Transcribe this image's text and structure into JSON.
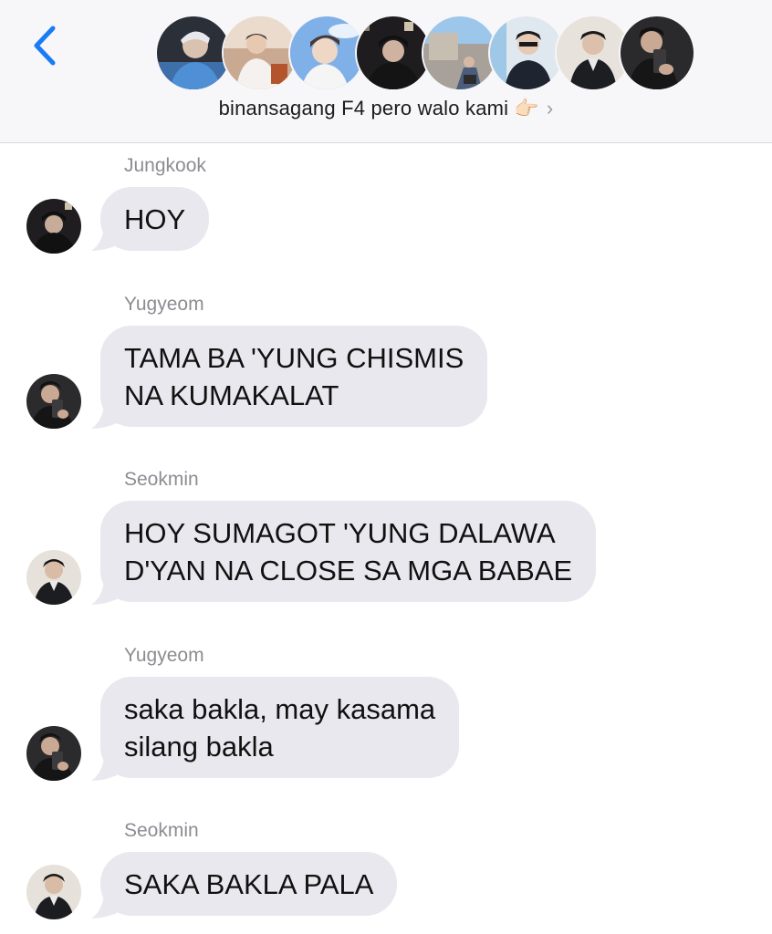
{
  "header": {
    "back_icon": "chevron-left-icon",
    "group_name": "binansagang F4 pero walo kami",
    "emoji": "👉🏻",
    "chevron": "›",
    "accent_color": "#1a7cf5",
    "avatar_count": 8
  },
  "messages": [
    {
      "sender": "Jungkook",
      "lines": [
        "HOY"
      ]
    },
    {
      "sender": "Yugyeom",
      "lines": [
        "TAMA BA 'YUNG CHISMIS",
        "NA KUMAKALAT"
      ]
    },
    {
      "sender": "Seokmin",
      "lines": [
        "HOY SUMAGOT 'YUNG DALAWA",
        "D'YAN NA CLOSE SA MGA BABAE"
      ]
    },
    {
      "sender": "Yugyeom",
      "lines": [
        "saka bakla, may kasama",
        "silang bakla"
      ]
    },
    {
      "sender": "Seokmin",
      "lines": [
        "SAKA BAKLA PALA"
      ]
    }
  ],
  "colors": {
    "bubble": "#e9e8ee",
    "header_bg": "#f7f6f8",
    "sender_text": "#8c8c92"
  }
}
